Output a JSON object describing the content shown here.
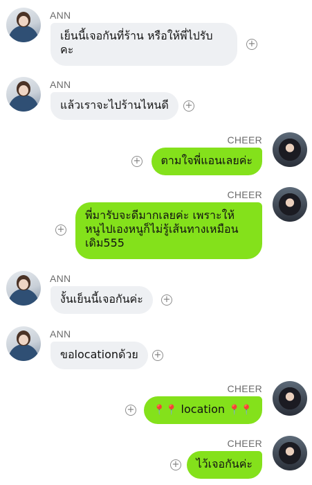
{
  "messages": [
    {
      "sender": "ANN",
      "text_line1": "เย็นนี้เจอกันที่ร้าน หรือให้พี่ไปรับ",
      "text_line2": "คะ"
    },
    {
      "sender": "ANN",
      "text": "แล้วเราจะไปร้านไหนดี"
    },
    {
      "sender": "CHEER",
      "text": "ตามใจพี่แอนเลยค่ะ"
    },
    {
      "sender": "CHEER",
      "text_line1": "พี่มารับจะดีมากเลยค่ะ เพราะให้",
      "text_line2": "หนูไปเองหนูก็ไม่รู้เส้นทางเหมือน",
      "text_line3": "เดิม555"
    },
    {
      "sender": "ANN",
      "text": "งั้นเย็นนี้เจอกันค่ะ"
    },
    {
      "sender": "ANN",
      "text": "ขอlocationด้วย"
    },
    {
      "sender": "CHEER",
      "pins_left": "📍📍",
      "text": "location",
      "pins_right": "📍📍"
    },
    {
      "sender": "CHEER",
      "text": "ไว้เจอกันค่ะ"
    }
  ],
  "icons": {
    "add": "plus-circle-icon",
    "pin": "round-pushpin-icon"
  },
  "colors": {
    "incoming_bubble": "#eef0f3",
    "outgoing_bubble": "#84e11b",
    "name_label": "#6b6b6b"
  }
}
